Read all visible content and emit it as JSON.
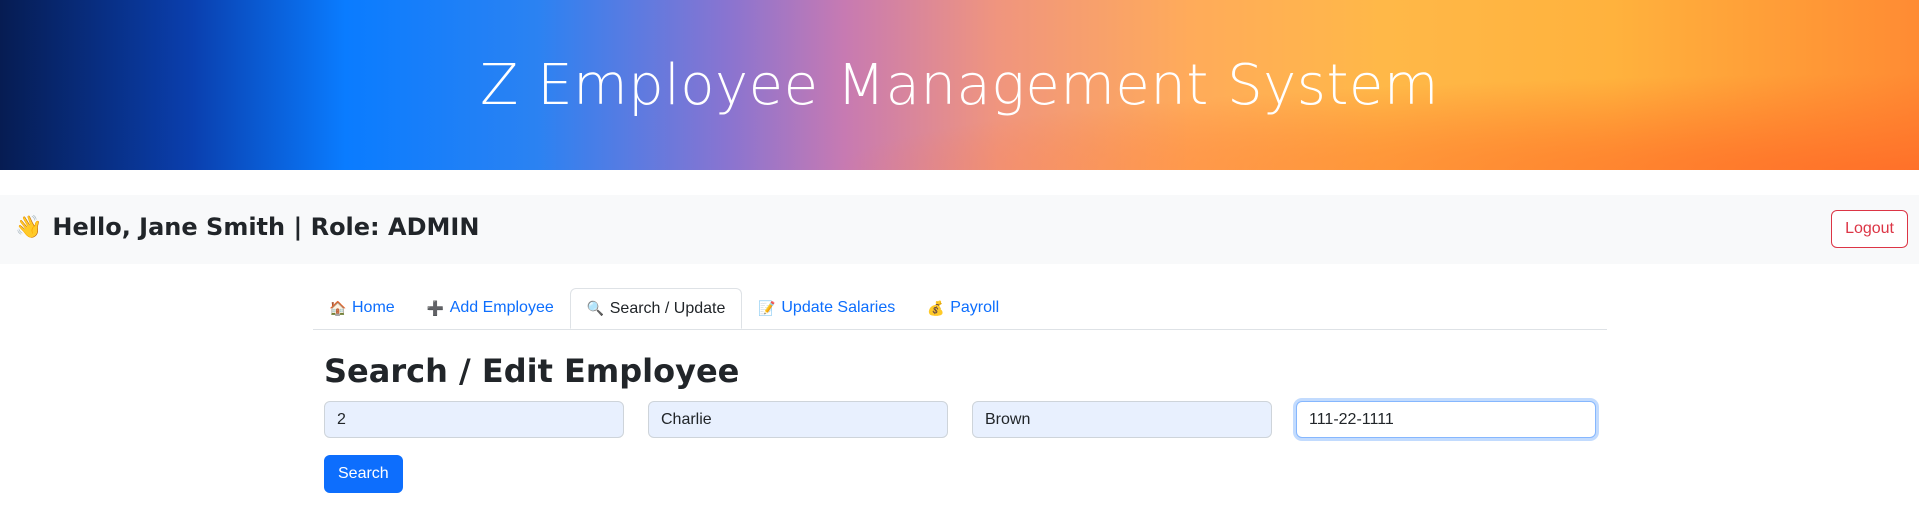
{
  "banner": {
    "title": "Z Employee Management System"
  },
  "userbar": {
    "greeting": "Hello, Jane Smith | Role: ADMIN",
    "wave_icon": "👋",
    "logout_label": "Logout"
  },
  "tabs": [
    {
      "icon": "🏠",
      "icon_name": "home-icon",
      "label": "Home",
      "active": false
    },
    {
      "icon": "➕",
      "icon_name": "plus-icon",
      "label": "Add Employee",
      "active": false
    },
    {
      "icon": "🔍",
      "icon_name": "magnifier-icon",
      "label": "Search / Update",
      "active": true
    },
    {
      "icon": "📝",
      "icon_name": "memo-icon",
      "label": "Update Salaries",
      "active": false
    },
    {
      "icon": "💰",
      "icon_name": "money-bag-icon",
      "label": "Payroll",
      "active": false
    }
  ],
  "main": {
    "title": "Search / Edit Employee",
    "fields": [
      {
        "value": "2"
      },
      {
        "value": "Charlie"
      },
      {
        "value": "Brown"
      },
      {
        "value": "111-22-1111"
      }
    ],
    "search_label": "Search"
  },
  "colors": {
    "primary": "#0d6efd",
    "danger": "#dc3545",
    "autofill_bg": "#e8f0fe"
  }
}
